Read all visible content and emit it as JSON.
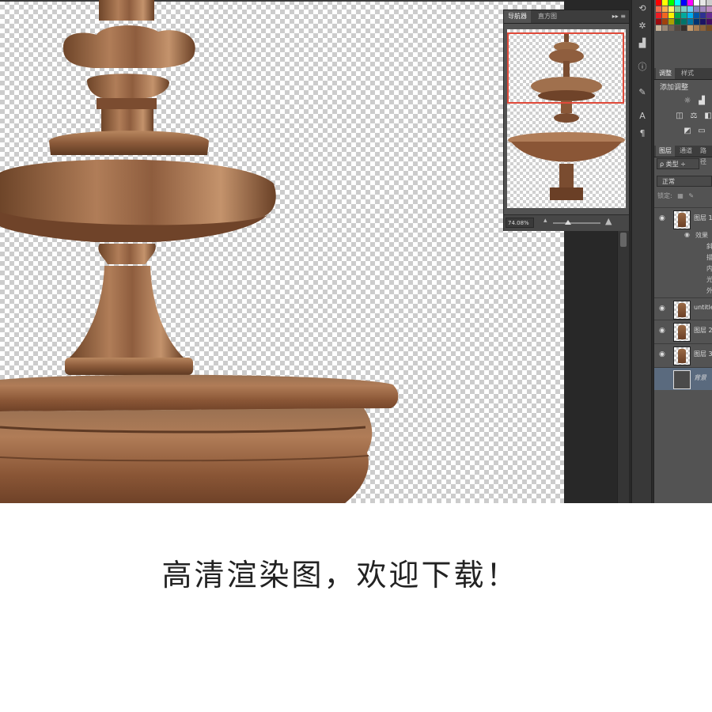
{
  "navigator": {
    "tabs": [
      "导航器",
      "直方图"
    ],
    "menu_glyph": "▸▸ ≡",
    "zoom_value": "74.08%",
    "zoom_slider_value": 0.32
  },
  "toolstrip": {
    "icons": [
      "history-icon",
      "brush-preset-icon",
      "histogram-icon",
      "info-icon",
      "brush-icon",
      "character-icon",
      "paragraph-icon"
    ]
  },
  "adjustments": {
    "tabs": [
      "调整",
      "样式"
    ],
    "title": "添加调整"
  },
  "layers": {
    "tabs": [
      "图层",
      "通道",
      "路径"
    ],
    "filter_label": "ρ 类型 ÷",
    "blend_mode": "正常",
    "lock_label": "锁定:",
    "items": [
      {
        "name": "图层 1",
        "selected": false
      },
      {
        "name": "untitled",
        "selected": false
      },
      {
        "name": "图层 2",
        "selected": false
      },
      {
        "name": "图层 3",
        "selected": false
      },
      {
        "name": "背景",
        "selected": true
      }
    ],
    "effects_label": "效果",
    "effects": [
      "斜",
      "描",
      "内",
      "光",
      "外"
    ]
  },
  "caption": "高清渲染图，欢迎下载！",
  "colors": {
    "panel_bg": "#535353",
    "panel_dark": "#383838",
    "nav_highlight": "#e04a3a",
    "bronze": "#8a5a3a"
  }
}
